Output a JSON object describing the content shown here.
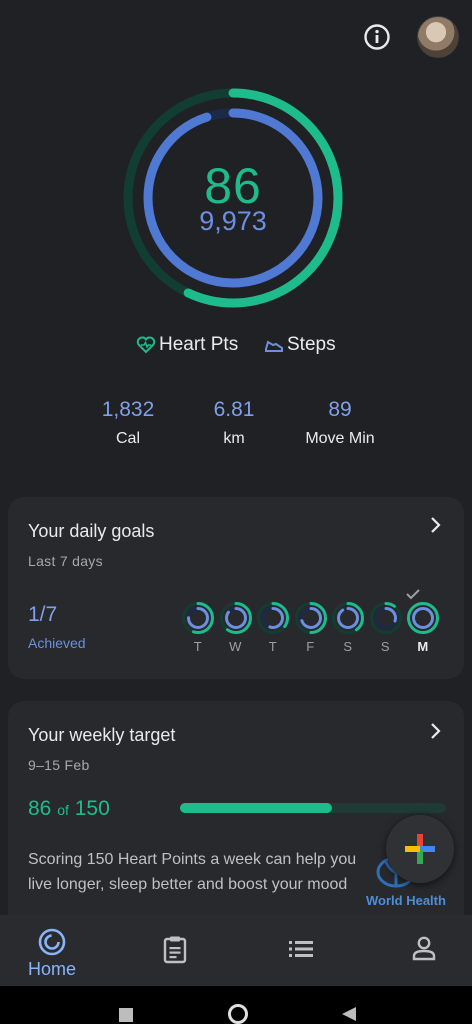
{
  "header": {
    "info_icon": "info-icon",
    "avatar_icon": "profile-avatar"
  },
  "summary": {
    "heart_points": "86",
    "steps": "9,973",
    "heart_points_progress": 0.57,
    "steps_progress": 0.95,
    "colors": {
      "heart_points": "#1ebc8c",
      "steps": "#4f79d2"
    }
  },
  "legend": {
    "heart_pts_label": "Heart Pts",
    "steps_label": "Steps"
  },
  "stats": {
    "cal": {
      "value": "1,832",
      "label": "Cal"
    },
    "km": {
      "value": "6.81",
      "label": "km"
    },
    "move": {
      "value": "89",
      "label": "Move Min"
    }
  },
  "daily_goals": {
    "title": "Your daily goals",
    "subtitle": "Last 7 days",
    "achieved_value": "1/7",
    "achieved_label": "Achieved",
    "days": [
      {
        "label": "T",
        "heart": 0.55,
        "steps": 0.75,
        "today": false
      },
      {
        "label": "W",
        "heart": 0.6,
        "steps": 0.85,
        "today": false
      },
      {
        "label": "T",
        "heart": 0.35,
        "steps": 0.55,
        "today": false
      },
      {
        "label": "F",
        "heart": 0.5,
        "steps": 0.7,
        "today": false
      },
      {
        "label": "S",
        "heart": 0.4,
        "steps": 0.9,
        "today": false
      },
      {
        "label": "S",
        "heart": 0.1,
        "steps": 0.3,
        "today": false
      },
      {
        "label": "M",
        "heart": 1.0,
        "steps": 1.0,
        "today": true
      }
    ]
  },
  "weekly_target": {
    "title": "Your weekly target",
    "date_range": "9–15 Feb",
    "current": "86",
    "of_text": "of",
    "goal": "150",
    "progress": 0.57,
    "description": "Scoring 150 Heart Points a week can help you live longer, sleep better and boost your mood"
  },
  "fab": {
    "icon": "add-plus-icon"
  },
  "who_logo_text": "World Health",
  "bottom_nav": [
    {
      "label": "Home",
      "icon": "home-rings-icon",
      "active": true
    },
    {
      "label": "",
      "icon": "journal-clipboard-icon",
      "active": false
    },
    {
      "label": "",
      "icon": "browse-list-icon",
      "active": false
    },
    {
      "label": "",
      "icon": "profile-icon",
      "active": false
    }
  ],
  "system_nav": {
    "recents": "square-icon",
    "home": "circle-icon",
    "back": "triangle-back-icon"
  }
}
